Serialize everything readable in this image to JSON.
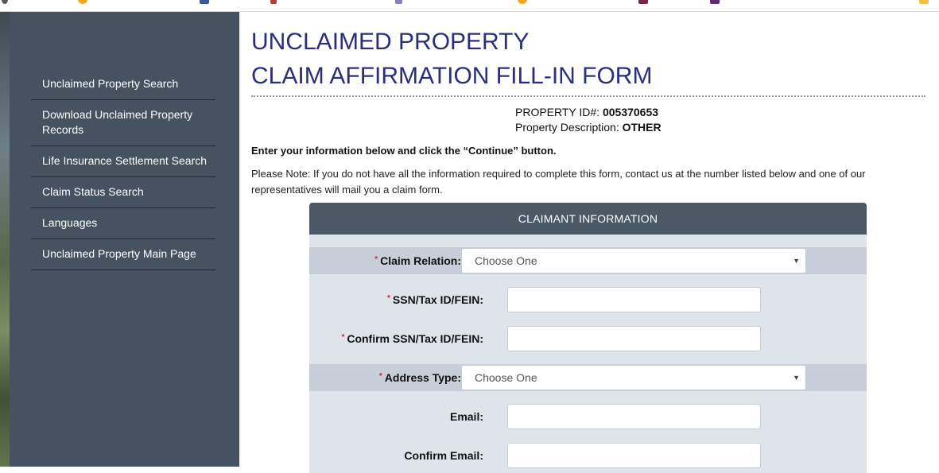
{
  "sidebar": {
    "items": [
      {
        "label": "Unclaimed Property Search"
      },
      {
        "label": "Download Unclaimed Property Records"
      },
      {
        "label": "Life Insurance Settlement Search"
      },
      {
        "label": "Claim Status Search"
      },
      {
        "label": "Languages"
      },
      {
        "label": "Unclaimed Property Main Page"
      }
    ]
  },
  "header": {
    "title_line1": "UNCLAIMED PROPERTY",
    "title_line2": "CLAIM AFFIRMATION FILL-IN FORM"
  },
  "property": {
    "id_label": "PROPERTY ID#:",
    "id_value": "005370653",
    "desc_label": "Property Description:",
    "desc_value": "OTHER"
  },
  "instructions": "Enter your information below and click the “Continue” button.",
  "note": "Please Note: If you do not have all the information required to complete this form, contact us at the number listed below and one of our representatives will mail you a claim form.",
  "form": {
    "section_title": "CLAIMANT INFORMATION",
    "required_mark": "*",
    "claim_relation": {
      "label": "Claim Relation:",
      "value": "Choose One"
    },
    "ssn": {
      "label": "SSN/Tax ID/FEIN:",
      "value": ""
    },
    "confirm_ssn": {
      "label": "Confirm SSN/Tax ID/FEIN:",
      "value": ""
    },
    "address_type": {
      "label": "Address Type:",
      "value": "Choose One"
    },
    "email": {
      "label": "Email:",
      "value": ""
    },
    "confirm_email": {
      "label": "Confirm Email:",
      "value": ""
    }
  },
  "icons": {
    "dropdown": "chevron-down-icon"
  },
  "colors": {
    "sidebar_bg": "#46525f",
    "title": "#2b2e7a",
    "panel_header": "#4b5866",
    "panel_bg": "#dfe3ea",
    "row_shade": "#c8ced8",
    "required": "#dd2222"
  }
}
